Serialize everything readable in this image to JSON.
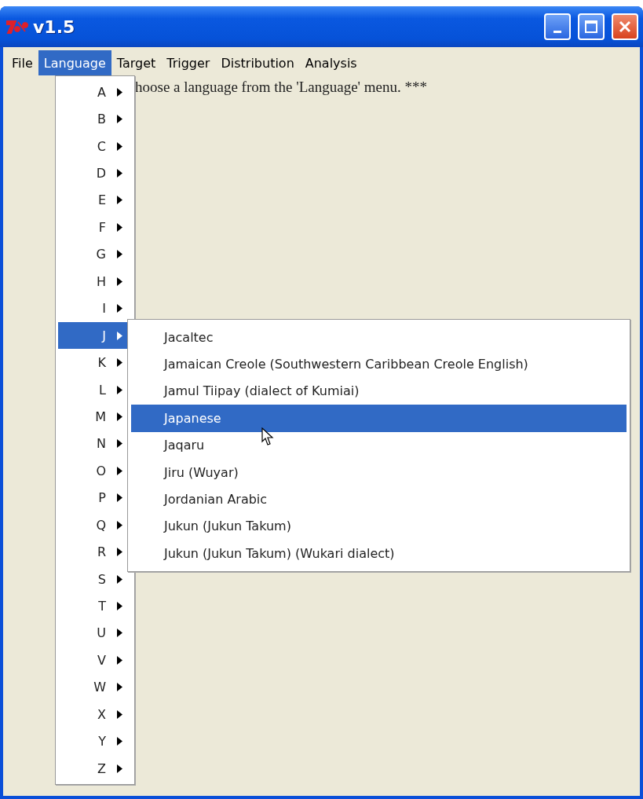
{
  "window": {
    "title": "v1.5"
  },
  "menu_bar": [
    {
      "label": "File",
      "selected": false
    },
    {
      "label": "Language",
      "selected": true
    },
    {
      "label": "Target",
      "selected": false
    },
    {
      "label": "Trigger",
      "selected": false
    },
    {
      "label": "Distribution",
      "selected": false
    },
    {
      "label": "Analysis",
      "selected": false
    }
  ],
  "message": "hoose a language from the 'Language' menu. ***",
  "letter_menu": [
    {
      "label": "A",
      "selected": false
    },
    {
      "label": "B",
      "selected": false
    },
    {
      "label": "C",
      "selected": false
    },
    {
      "label": "D",
      "selected": false
    },
    {
      "label": "E",
      "selected": false
    },
    {
      "label": "F",
      "selected": false
    },
    {
      "label": "G",
      "selected": false
    },
    {
      "label": "H",
      "selected": false
    },
    {
      "label": "I",
      "selected": false
    },
    {
      "label": "J",
      "selected": true
    },
    {
      "label": "K",
      "selected": false
    },
    {
      "label": "L",
      "selected": false
    },
    {
      "label": "M",
      "selected": false
    },
    {
      "label": "N",
      "selected": false
    },
    {
      "label": "O",
      "selected": false
    },
    {
      "label": "P",
      "selected": false
    },
    {
      "label": "Q",
      "selected": false
    },
    {
      "label": "R",
      "selected": false
    },
    {
      "label": "S",
      "selected": false
    },
    {
      "label": "T",
      "selected": false
    },
    {
      "label": "U",
      "selected": false
    },
    {
      "label": "V",
      "selected": false
    },
    {
      "label": "W",
      "selected": false
    },
    {
      "label": "X",
      "selected": false
    },
    {
      "label": "Y",
      "selected": false
    },
    {
      "label": "Z",
      "selected": false
    }
  ],
  "submenu": [
    {
      "label": "Jacaltec",
      "selected": false
    },
    {
      "label": "Jamaican Creole (Southwestern Caribbean Creole English)",
      "selected": false
    },
    {
      "label": "Jamul Tiipay (dialect of Kumiai)",
      "selected": false
    },
    {
      "label": "Japanese",
      "selected": true
    },
    {
      "label": "Jaqaru",
      "selected": false
    },
    {
      "label": "Jiru (Wuyar)",
      "selected": false
    },
    {
      "label": "Jordanian Arabic",
      "selected": false
    },
    {
      "label": "Jukun (Jukun Takum)",
      "selected": false
    },
    {
      "label": "Jukun (Jukun Takum) (Wukari dialect)",
      "selected": false
    }
  ]
}
